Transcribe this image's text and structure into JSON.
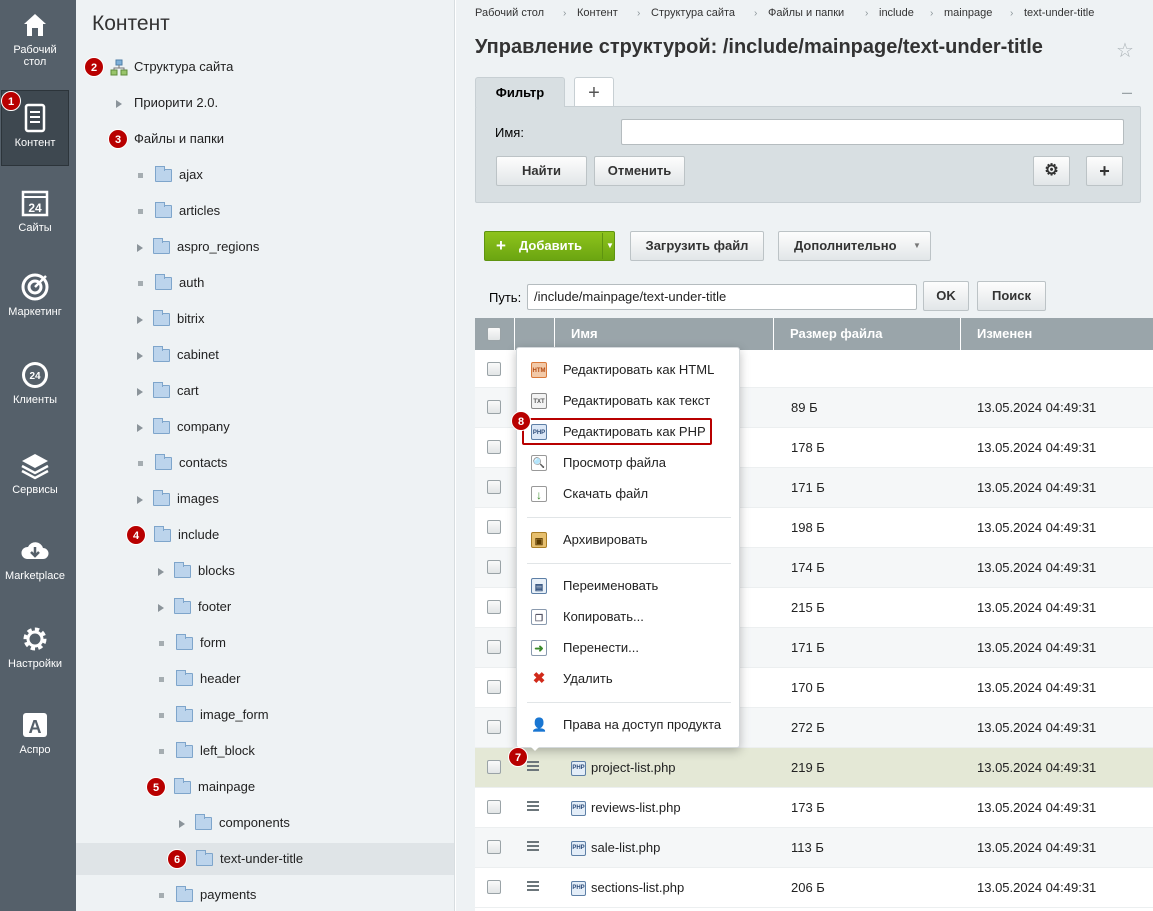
{
  "nav": {
    "items": [
      {
        "label": "Рабочий стол",
        "icon": "home-icon"
      },
      {
        "label": "Контент",
        "icon": "document-icon",
        "active": true
      },
      {
        "label": "Сайты",
        "icon": "calendar-24-icon"
      },
      {
        "label": "Маркетинг",
        "icon": "target-icon"
      },
      {
        "label": "Клиенты",
        "icon": "clients-24-icon"
      },
      {
        "label": "Сервисы",
        "icon": "layers-icon"
      },
      {
        "label": "Marketplace",
        "icon": "cloud-download-icon"
      },
      {
        "label": "Настройки",
        "icon": "gear-icon"
      },
      {
        "label": "Аспро",
        "icon": "letter-a-icon"
      }
    ]
  },
  "tree": {
    "title": "Контент",
    "nodes": [
      {
        "label": "Структура сайта"
      },
      {
        "label": "Приорити 2.0."
      },
      {
        "label": "Файлы и папки"
      },
      {
        "label": "ajax"
      },
      {
        "label": "articles"
      },
      {
        "label": "aspro_regions"
      },
      {
        "label": "auth"
      },
      {
        "label": "bitrix"
      },
      {
        "label": "cabinet"
      },
      {
        "label": "cart"
      },
      {
        "label": "company"
      },
      {
        "label": "contacts"
      },
      {
        "label": "images"
      },
      {
        "label": "include"
      },
      {
        "label": "blocks"
      },
      {
        "label": "footer"
      },
      {
        "label": "form"
      },
      {
        "label": "header"
      },
      {
        "label": "image_form"
      },
      {
        "label": "left_block"
      },
      {
        "label": "mainpage"
      },
      {
        "label": "components"
      },
      {
        "label": "text-under-title"
      },
      {
        "label": "payments"
      }
    ]
  },
  "badges": [
    "1",
    "2",
    "3",
    "4",
    "5",
    "6",
    "7",
    "8"
  ],
  "breadcrumb": [
    "Рабочий стол",
    "Контент",
    "Структура сайта",
    "Файлы и папки",
    "include",
    "mainpage",
    "text-under-title"
  ],
  "page_title": "Управление структурой: /include/mainpage/text-under-title",
  "filter": {
    "tab_label": "Фильтр",
    "add_tab": "+",
    "collapse": "–",
    "name_label": "Имя:",
    "name_value": "",
    "find_label": "Найти",
    "cancel_label": "Отменить",
    "settings": "⚙",
    "add": "+"
  },
  "toolbar": {
    "add_label": "Добавить",
    "upload_label": "Загрузить файл",
    "more_label": "Дополнительно",
    "path_label": "Путь:",
    "path_value": "/include/mainpage/text-under-title",
    "ok_label": "OK",
    "search_label": "Поиск"
  },
  "table": {
    "headers": [
      "Имя",
      "Размер файла",
      "Изменен"
    ],
    "rows": [
      {
        "name": "",
        "size": "",
        "date": ""
      },
      {
        "name": "",
        "size": "89 Б",
        "date": "13.05.2024 04:49:31"
      },
      {
        "name": "",
        "size": "178 Б",
        "date": "13.05.2024 04:49:31"
      },
      {
        "name": "",
        "size": "171 Б",
        "date": "13.05.2024 04:49:31"
      },
      {
        "name": "",
        "size": "198 Б",
        "date": "13.05.2024 04:49:31"
      },
      {
        "name": "",
        "size": "174 Б",
        "date": "13.05.2024 04:49:31"
      },
      {
        "name": "",
        "size": "215 Б",
        "date": "13.05.2024 04:49:31"
      },
      {
        "name": "",
        "size": "171 Б",
        "date": "13.05.2024 04:49:31"
      },
      {
        "name": "",
        "size": "170 Б",
        "date": "13.05.2024 04:49:31"
      },
      {
        "name": "",
        "size": "272 Б",
        "date": "13.05.2024 04:49:31"
      },
      {
        "name": "project-list.php",
        "size": "219 Б",
        "date": "13.05.2024 04:49:31"
      },
      {
        "name": "reviews-list.php",
        "size": "173 Б",
        "date": "13.05.2024 04:49:31"
      },
      {
        "name": "sale-list.php",
        "size": "113 Б",
        "date": "13.05.2024 04:49:31"
      },
      {
        "name": "sections-list.php",
        "size": "206 Б",
        "date": "13.05.2024 04:49:31"
      }
    ]
  },
  "context_menu": {
    "items": [
      {
        "label": "Редактировать как HTML",
        "icon": "html-edit-icon"
      },
      {
        "label": "Редактировать как текст",
        "icon": "txt-edit-icon"
      },
      {
        "label": "Редактировать как PHP",
        "icon": "php-edit-icon",
        "highlighted": true
      },
      {
        "label": "Просмотр файла",
        "icon": "view-file-icon"
      },
      {
        "label": "Скачать файл",
        "icon": "download-icon"
      },
      {
        "label": "Архивировать",
        "icon": "archive-icon"
      },
      {
        "label": "Переименовать",
        "icon": "rename-icon"
      },
      {
        "label": "Копировать...",
        "icon": "copy-icon"
      },
      {
        "label": "Перенести...",
        "icon": "move-icon"
      },
      {
        "label": "Удалить",
        "icon": "delete-icon"
      },
      {
        "label": "Права на доступ продукта",
        "icon": "permissions-icon"
      }
    ]
  },
  "colors": {
    "nav_bg": "#55606a",
    "badge": "#b80000",
    "green_button": "#7ab317",
    "header_bg": "#9aa5aa"
  }
}
